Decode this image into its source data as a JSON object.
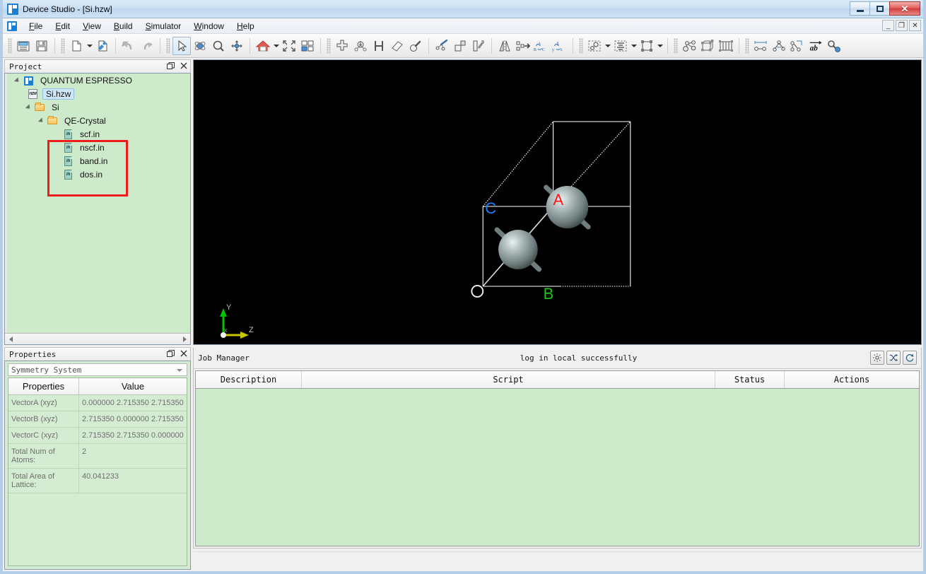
{
  "window": {
    "title": "Device Studio - [Si.hzw]",
    "logo_icon": "device-studio-logo",
    "minimize_label": "Minimize",
    "restore_label": "Restore",
    "close_label": "Close"
  },
  "mdi": {
    "minimize_label": "_",
    "restore_label": "❐",
    "close_label": "×"
  },
  "menu": [
    {
      "label": "File",
      "mnemonic": "F"
    },
    {
      "label": "Edit",
      "mnemonic": "E"
    },
    {
      "label": "View",
      "mnemonic": "V"
    },
    {
      "label": "Build",
      "mnemonic": "B"
    },
    {
      "label": "Simulator",
      "mnemonic": "S"
    },
    {
      "label": "Window",
      "mnemonic": "W"
    },
    {
      "label": "Help",
      "mnemonic": "H"
    }
  ],
  "toolbar": {
    "groups": [
      {
        "items": [
          {
            "icon": "open-project-icon",
            "label": "Open Project"
          },
          {
            "icon": "save-icon",
            "label": "Save"
          }
        ]
      },
      {
        "items": [
          {
            "icon": "new-file-icon",
            "label": "New",
            "dropdown": true
          },
          {
            "icon": "import-file-icon",
            "label": "Import"
          },
          {
            "icon": "undo-icon",
            "label": "Undo"
          },
          {
            "icon": "redo-icon",
            "label": "Redo"
          }
        ]
      },
      {
        "items": [
          {
            "icon": "select-pointer-icon",
            "label": "Select",
            "active": true
          },
          {
            "icon": "rotate-icon",
            "label": "Rotate"
          },
          {
            "icon": "zoom-icon",
            "label": "Zoom"
          },
          {
            "icon": "pan-icon",
            "label": "Pan"
          }
        ]
      },
      {
        "items": [
          {
            "icon": "home-view-icon",
            "label": "Home View",
            "dropdown": true
          },
          {
            "icon": "fit-view-icon",
            "label": "Fit to Window"
          },
          {
            "icon": "layout-view-icon",
            "label": "Layout"
          }
        ]
      },
      {
        "items": [
          {
            "icon": "add-atom-icon",
            "label": "Add Atom"
          },
          {
            "icon": "add-molecule-icon",
            "label": "Add Molecule"
          },
          {
            "icon": "add-hydrogen-icon",
            "label": "Add Hydrogen"
          },
          {
            "icon": "eraser-icon",
            "label": "Erase"
          },
          {
            "icon": "measure-bond-icon",
            "label": "Bond Tool"
          }
        ]
      },
      {
        "items": [
          {
            "icon": "edit-bond-icon",
            "label": "Edit Bond"
          },
          {
            "icon": "supercell-icon",
            "label": "Supercell"
          },
          {
            "icon": "slab-icon",
            "label": "Slab"
          }
        ]
      },
      {
        "items": [
          {
            "icon": "mirror-icon",
            "label": "Mirror"
          },
          {
            "icon": "transform-icon",
            "label": "Transform"
          },
          {
            "icon": "abc-axes-icon",
            "label": "ABC Axes"
          },
          {
            "icon": "xyz-axes-icon",
            "label": "XYZ Axes"
          }
        ]
      },
      {
        "items": [
          {
            "icon": "cluster-icon",
            "label": "Cluster",
            "dropdown": true
          },
          {
            "icon": "align-icon",
            "label": "Align",
            "dropdown": true
          },
          {
            "icon": "lattice-box-icon",
            "label": "Lattice",
            "dropdown": true
          }
        ]
      },
      {
        "items": [
          {
            "icon": "molecule-graph-icon",
            "label": "Molecule"
          },
          {
            "icon": "crystal-graph-icon",
            "label": "Crystal"
          },
          {
            "icon": "device-graph-icon",
            "label": "Device"
          }
        ]
      },
      {
        "items": [
          {
            "icon": "measure-distance-icon",
            "label": "Measure Distance"
          },
          {
            "icon": "measure-angle-icon",
            "label": "Measure Angle"
          },
          {
            "icon": "measure-dihedral-icon",
            "label": "Measure Dihedral"
          },
          {
            "icon": "vector-ab-icon",
            "label": "Vector ab"
          },
          {
            "icon": "probe-icon",
            "label": "Probe"
          }
        ]
      }
    ]
  },
  "project_panel": {
    "title": "Project",
    "float_icon": "float-panel-icon",
    "close_icon": "close-panel-icon",
    "tree": [
      {
        "label": "QUANTUM ESPRESSO",
        "icon": "project-icon",
        "indent": 0,
        "twisty": true,
        "selected": false
      },
      {
        "label": "Si.hzw",
        "icon": "hzw-file-icon",
        "icon_text": "HZW",
        "indent": 1,
        "twisty": false,
        "selected": true
      },
      {
        "label": "Si",
        "icon": "folder-icon",
        "indent": 1,
        "twisty": true,
        "selected": false
      },
      {
        "label": "QE-Crystal",
        "icon": "folder-icon",
        "indent": 2,
        "twisty": true,
        "selected": false
      },
      {
        "label": "scf.in",
        "icon": "in-file-icon",
        "icon_text": "IN",
        "indent": 3,
        "twisty": false,
        "selected": false
      },
      {
        "label": "nscf.in",
        "icon": "in-file-icon",
        "icon_text": "IN",
        "indent": 3,
        "twisty": false,
        "selected": false
      },
      {
        "label": "band.in",
        "icon": "in-file-icon",
        "icon_text": "IN",
        "indent": 3,
        "twisty": false,
        "selected": false
      },
      {
        "label": "dos.in",
        "icon": "in-file-icon",
        "icon_text": "IN",
        "indent": 3,
        "twisty": false,
        "selected": false
      }
    ],
    "highlight_color": "#f01c1c"
  },
  "properties_panel": {
    "title": "Properties",
    "float_icon": "float-panel-icon",
    "close_icon": "close-panel-icon",
    "selector_value": "Symmetry System",
    "columns": [
      "Properties",
      "Value"
    ],
    "rows": [
      {
        "name": "VectorA (xyz)",
        "value": "0.000000 2.715350 2.715350"
      },
      {
        "name": "VectorB (xyz)",
        "value": "2.715350 0.000000 2.715350"
      },
      {
        "name": "VectorC (xyz)",
        "value": "2.715350 2.715350 0.000000"
      },
      {
        "name": "Total Num of Atoms:",
        "value": "2"
      },
      {
        "name": "Total Area of Lattice:",
        "value": "40.041233"
      }
    ]
  },
  "viewport": {
    "background": "#000000",
    "cell_labels": [
      {
        "text": "O",
        "color": "#e8e8e8"
      },
      {
        "text": "A",
        "color": "#ff1414"
      },
      {
        "text": "B",
        "color": "#14c814"
      },
      {
        "text": "C",
        "color": "#1e7eff"
      }
    ],
    "axis_gizmo": {
      "x_label": "x",
      "x_color": "#ffffff",
      "y_label": "Y",
      "y_color": "#00c000",
      "z_label": "Z",
      "z_color": "#c8c800"
    },
    "atoms": [
      {
        "element": "Si",
        "color": "#8a9a9a"
      },
      {
        "element": "Si",
        "color": "#8a9a9a"
      }
    ]
  },
  "job_manager": {
    "title": "Job Manager",
    "status_message": "log in local successfully",
    "buttons": [
      {
        "icon": "gear-icon",
        "label": "Settings"
      },
      {
        "icon": "shuffle-icon",
        "label": "Transfer"
      },
      {
        "icon": "refresh-icon",
        "label": "Refresh"
      }
    ],
    "columns": [
      "Description",
      "Script",
      "Status",
      "Actions"
    ],
    "rows": []
  }
}
